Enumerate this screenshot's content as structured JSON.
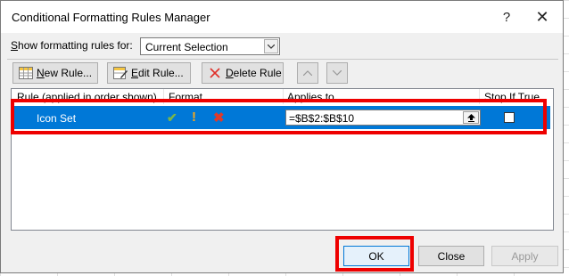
{
  "dialog": {
    "title": "Conditional Formatting Rules Manager",
    "help_label": "?",
    "close_label": "✕"
  },
  "show_rules": {
    "label_prefix": "",
    "label_underlined": "S",
    "label_rest": "how formatting rules for:",
    "selected": "Current Selection"
  },
  "toolbar": {
    "new_rule": {
      "prefix": "",
      "underlined": "N",
      "rest": "ew Rule..."
    },
    "edit_rule": {
      "prefix": "",
      "underlined": "E",
      "rest": "dit Rule..."
    },
    "delete_rule": {
      "prefix": "",
      "underlined": "D",
      "rest": "elete Rule"
    }
  },
  "grid": {
    "columns": [
      "Rule (applied in order shown)",
      "Format",
      "Applies to",
      "Stop If True"
    ],
    "rows": [
      {
        "rule": "Icon Set",
        "applies_to": "=$B$2:$B$10",
        "stop_if_true": false,
        "format_icons": [
          "check-icon",
          "exclamation-icon",
          "cross-icon"
        ]
      }
    ]
  },
  "buttons": {
    "ok": "OK",
    "close": "Close",
    "apply": "Apply"
  },
  "colors": {
    "selection": "#0078d7",
    "highlight": "#ee0000"
  }
}
